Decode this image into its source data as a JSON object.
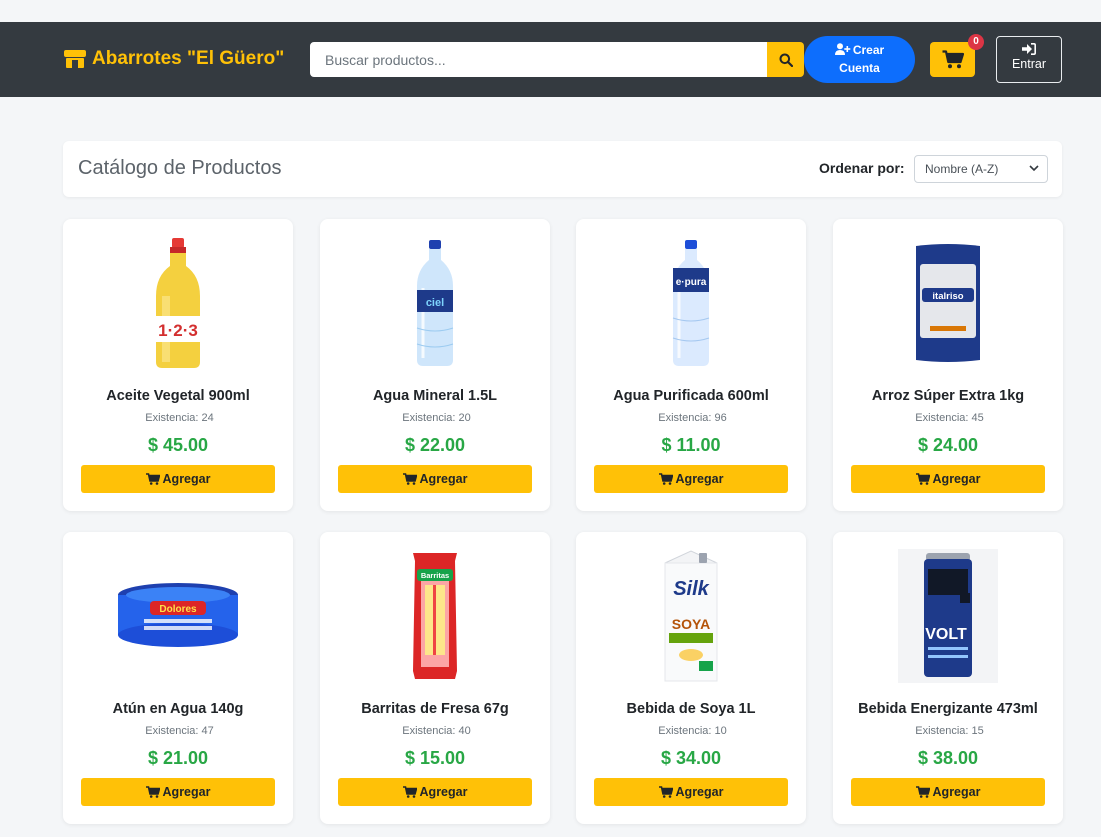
{
  "header": {
    "brand": "Abarrotes \"El Güero\"",
    "search_placeholder": "Buscar productos...",
    "create_label": "Crear",
    "create_label2": "Cuenta",
    "cart_count": "0",
    "login_label": "Entrar"
  },
  "catalog": {
    "title": "Catálogo de Productos",
    "sort_label": "Ordenar por:",
    "sort_value": "Nombre (A-Z)"
  },
  "stock_label": "Existencia:",
  "add_label": "Agregar",
  "products": [
    {
      "name": "Aceite Vegetal 900ml",
      "stock": "24",
      "price": "$ 45.00",
      "image": "oil-bottle"
    },
    {
      "name": "Agua Mineral 1.5L",
      "stock": "20",
      "price": "$ 22.00",
      "image": "water-bottle"
    },
    {
      "name": "Agua Purificada 600ml",
      "stock": "96",
      "price": "$ 11.00",
      "image": "water-bottle-small"
    },
    {
      "name": "Arroz Súper Extra 1kg",
      "stock": "45",
      "price": "$ 24.00",
      "image": "rice-bag"
    },
    {
      "name": "Atún en Agua 140g",
      "stock": "47",
      "price": "$ 21.00",
      "image": "tuna-can"
    },
    {
      "name": "Barritas de Fresa 67g",
      "stock": "40",
      "price": "$ 15.00",
      "image": "bar-pack"
    },
    {
      "name": "Bebida de Soya 1L",
      "stock": "10",
      "price": "$ 34.00",
      "image": "soy-carton"
    },
    {
      "name": "Bebida Energizante 473ml",
      "stock": "15",
      "price": "$ 38.00",
      "image": "energy-can"
    }
  ],
  "colors": {
    "accent": "#ffc107",
    "navbar": "#343a40",
    "price": "#28a745",
    "primary": "#0d6efd",
    "badge": "#dc3545"
  }
}
